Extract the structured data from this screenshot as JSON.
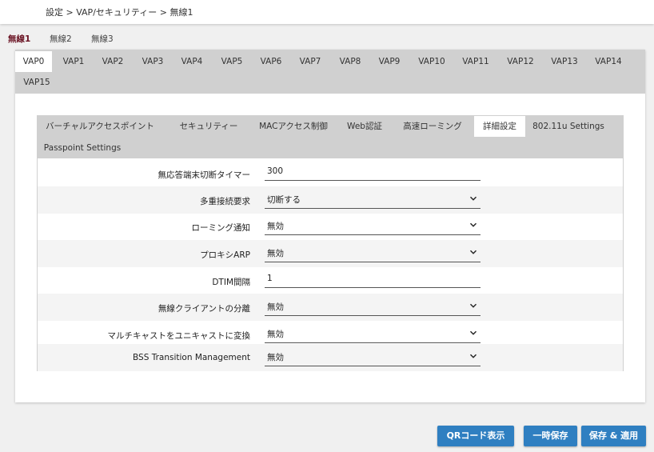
{
  "breadcrumb": "設定 > VAP/セキュリティー > 無線1",
  "radio_tabs": [
    "無線1",
    "無線2",
    "無線3"
  ],
  "vap_tabs": [
    "VAP0",
    "VAP1",
    "VAP2",
    "VAP3",
    "VAP4",
    "VAP5",
    "VAP6",
    "VAP7",
    "VAP8",
    "VAP9",
    "VAP10",
    "VAP11",
    "VAP12",
    "VAP13",
    "VAP14",
    "VAP15"
  ],
  "sub_tabs": [
    "バーチャルアクセスポイント",
    "セキュリティー",
    "MACアクセス制御",
    "Web認証",
    "高速ローミング",
    "詳細設定",
    "802.11u Settings",
    "Passpoint Settings"
  ],
  "fields": [
    {
      "label": "無応答端末切断タイマー",
      "value": "300",
      "kind": "input"
    },
    {
      "label": "多重接続要求",
      "value": "切断する",
      "kind": "select"
    },
    {
      "label": "ローミング通知",
      "value": "無効",
      "kind": "select"
    },
    {
      "label": "プロキシARP",
      "value": "無効",
      "kind": "select"
    },
    {
      "label": "DTIM間隔",
      "value": "1",
      "kind": "input"
    },
    {
      "label": "無線クライアントの分離",
      "value": "無効",
      "kind": "select"
    },
    {
      "label": "マルチキャストをユニキャストに変換",
      "value": "無効",
      "kind": "select"
    },
    {
      "label": "BSS Transition Management",
      "value": "無効",
      "kind": "select"
    }
  ],
  "buttons": {
    "qr": "QRコード表示",
    "temp_save": "一時保存",
    "save_apply": "保存 & 適用"
  },
  "colors": {
    "accent": "#2f7fc1",
    "active_radio": "#6b1424",
    "tab_bar": "#d0d0d0"
  },
  "icons": {
    "select_arrow": "chevron-down-icon"
  }
}
